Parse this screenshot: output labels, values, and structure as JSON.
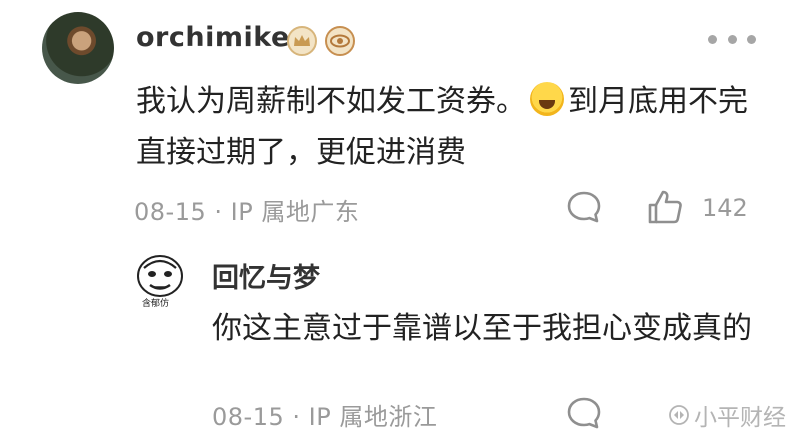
{
  "comment": {
    "username": "orchimike",
    "content_part1": "我认为周薪制不如发工资券。",
    "content_part2": "到月底用不完直接过期了，更促进消费",
    "emoji_icon": "face-with-tears-of-joy-icon",
    "date": "08-15",
    "separator": "·",
    "ip_label": "IP 属地广东",
    "like_count": "142"
  },
  "reply": {
    "avatar_caption": "含郁仿",
    "username": "回忆与梦",
    "content": "你这主意过于靠谱以至于我担心变成真的",
    "date": "08-15",
    "separator": "·",
    "ip_label": "IP 属地浙江"
  },
  "watermark": {
    "text": "小平财经"
  },
  "colors": {
    "text_primary": "#222222",
    "text_meta": "#9a9a9a",
    "badge_gold": "#d7b57b"
  }
}
